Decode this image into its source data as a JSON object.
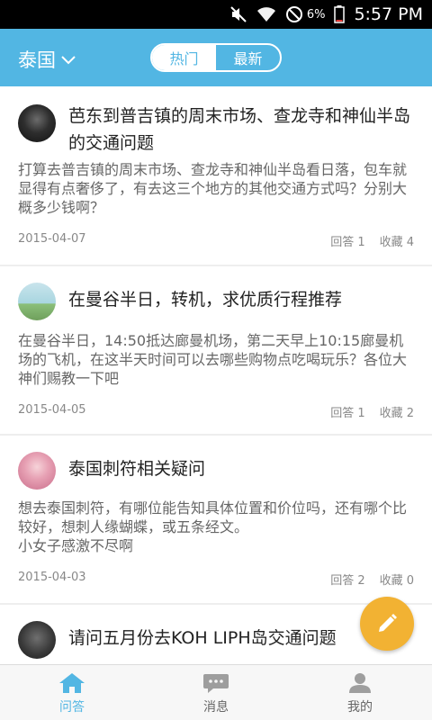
{
  "status_bar": {
    "battery_percent": "6%",
    "time": "5:57 PM"
  },
  "header": {
    "region": "泰国",
    "tabs": [
      {
        "label": "热门",
        "active": true
      },
      {
        "label": "最新",
        "active": false
      }
    ]
  },
  "questions": [
    {
      "title": "芭东到普吉镇的周末市场、查龙寺和神仙半岛的交通问题",
      "body": "打算去普吉镇的周末市场、查龙寺和神仙半岛看日落，包车就显得有点奢侈了，有去这三个地方的其他交通方式吗？分别大概多少钱啊？",
      "date": "2015-04-07",
      "answers_label": "回答 1",
      "favorites_label": "收藏 4"
    },
    {
      "title": "在曼谷半日，转机，求优质行程推荐",
      "body": "在曼谷半日，14:50抵达廊曼机场，第二天早上10:15廊曼机场的飞机，在这半天时间可以去哪些购物点吃喝玩乐？各位大神们赐教一下吧",
      "date": "2015-04-05",
      "answers_label": "回答 1",
      "favorites_label": "收藏 2"
    },
    {
      "title": "泰国刺符相关疑问",
      "body": "想去泰国刺符，有哪位能告知具体位置和价位吗，还有哪个比较好，想刺人缘蝴蝶，或五条经文。\n小女子感激不尽啊",
      "date": "2015-04-03",
      "answers_label": "回答 2",
      "favorites_label": "收藏 0"
    },
    {
      "title": "请问五月份去KOH LIPH岛交通问题",
      "body": "",
      "date": "",
      "answers_label": "",
      "favorites_label": ""
    }
  ],
  "bottom_nav": [
    {
      "label": "问答",
      "icon": "home-icon",
      "active": true
    },
    {
      "label": "消息",
      "icon": "chat-bubble-icon",
      "active": false
    },
    {
      "label": "我的",
      "icon": "person-icon",
      "active": false
    }
  ],
  "colors": {
    "accent": "#52b6e3",
    "fab": "#f2b233",
    "text_primary": "#222222",
    "text_secondary": "#666666",
    "background": "#eeeeee"
  }
}
